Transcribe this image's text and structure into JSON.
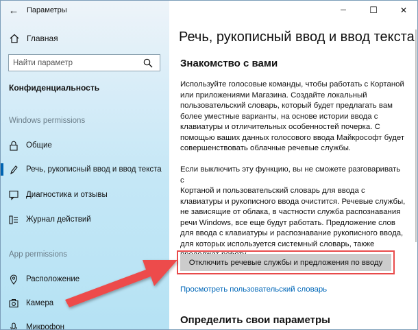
{
  "window": {
    "title": "Параметры",
    "controls": {
      "minimize": "─",
      "maximize": "☐",
      "close": "✕"
    }
  },
  "sidebar": {
    "back": "←",
    "home_label": "Главная",
    "search": {
      "placeholder": "Найти параметр"
    },
    "section_title": "Конфиденциальность",
    "windows_header": "Windows permissions",
    "windows_items": [
      {
        "label": "Общие",
        "icon": "lock-icon"
      },
      {
        "label": "Речь, рукописный ввод и ввод текста",
        "icon": "pen-icon",
        "active": true
      },
      {
        "label": "Диагностика и отзывы",
        "icon": "feedback-icon"
      },
      {
        "label": "Журнал действий",
        "icon": "timeline-icon"
      }
    ],
    "app_header": "App permissions",
    "app_items": [
      {
        "label": "Расположение",
        "icon": "location-icon"
      },
      {
        "label": "Камера",
        "icon": "camera-icon"
      },
      {
        "label": "Микрофон",
        "icon": "microphone-icon"
      }
    ]
  },
  "main": {
    "page_title": "Речь, рукописный ввод и ввод текста",
    "section_title": "Знакомство с вами",
    "paragraph1_lines": [
      "Используйте голосовые команды, чтобы работать с Кортаной",
      "или приложениями Магазина. Создайте локальный",
      "пользовательский словарь, который будет предлагать вам",
      "более уместные варианты, на основе истории ввода с",
      "клавиатуры и отличительных особенностей почерка. С",
      "помощью ваших данных голосового ввода Майкрософт будет",
      "совершенствовать облачные речевые службы."
    ],
    "paragraph2_lines": [
      "Если выключить эту функцию, вы не сможете разговаривать с",
      "Кортаной и пользовательский словарь для ввода с",
      "клавиатуры и рукописного ввода очистится. Речевые службы,",
      "не зависящие от облака, в частности служба распознавания",
      "речи Windows, все еще будут работать. Предложение слов",
      "для ввода с клавиатуры и распознавание рукописного ввода,",
      "для которых используется системный словарь, также",
      "продолжат работу."
    ],
    "disable_button": "Отключить речевые службы и предложения по вводу",
    "view_dictionary_link": "Просмотреть пользовательский словарь",
    "section2_title": "Определить свои параметры"
  },
  "colors": {
    "accent": "#0063b1",
    "link": "#0067b8",
    "annotation_red": "#e84a4a"
  }
}
